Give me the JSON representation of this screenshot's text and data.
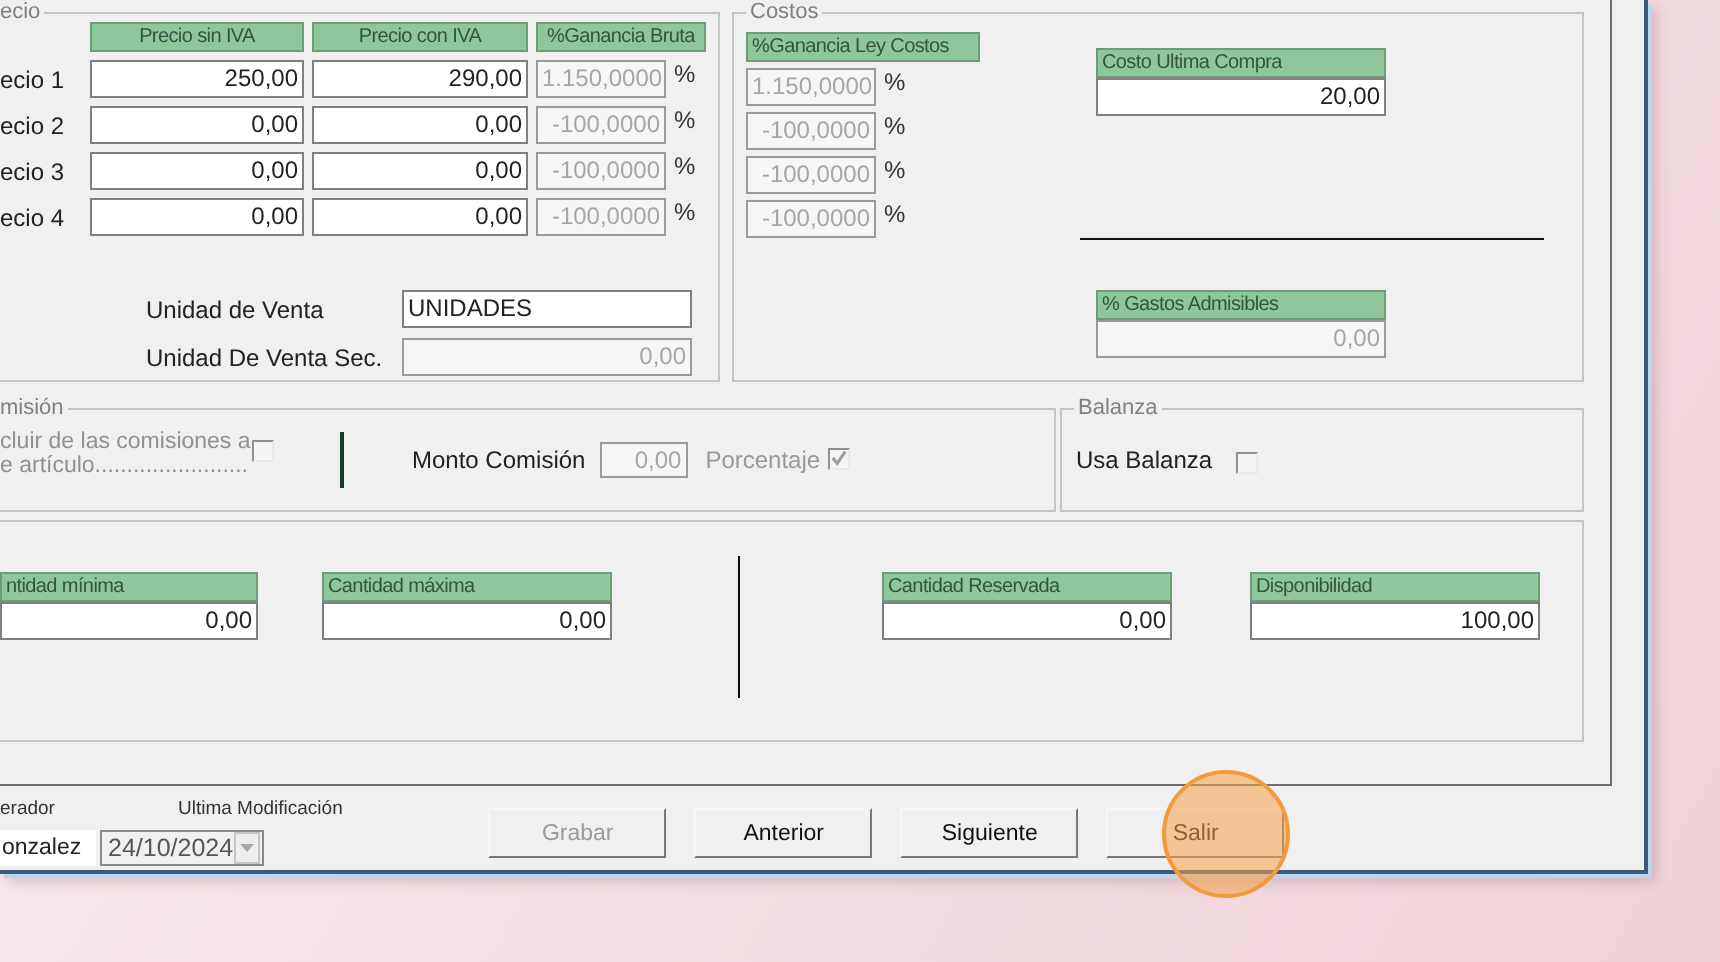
{
  "precio": {
    "legend": "ecio",
    "columns": [
      "Precio sin IVA",
      "Precio con IVA",
      "%Ganancia Bruta"
    ],
    "rows": [
      {
        "label": "ecio 1",
        "sin_iva": "250,00",
        "con_iva": "290,00",
        "ganancia": "1.150,0000",
        "unit": "%"
      },
      {
        "label": "ecio 2",
        "sin_iva": "0,00",
        "con_iva": "0,00",
        "ganancia": "-100,0000",
        "unit": "%"
      },
      {
        "label": "ecio 3",
        "sin_iva": "0,00",
        "con_iva": "0,00",
        "ganancia": "-100,0000",
        "unit": "%"
      },
      {
        "label": "ecio 4",
        "sin_iva": "0,00",
        "con_iva": "0,00",
        "ganancia": "-100,0000",
        "unit": "%"
      }
    ],
    "unidades": [
      {
        "label": "Unidad de Venta",
        "value": "UNIDADES",
        "disabled": false
      },
      {
        "label": "Unidad De Venta Sec.",
        "value": "0,00",
        "disabled": true
      }
    ]
  },
  "costos": {
    "legend": "Costos",
    "ganancia_header": "%Ganancia Ley Costos",
    "ganancia_rows": [
      {
        "value": "1.150,0000",
        "unit": "%"
      },
      {
        "value": "-100,0000",
        "unit": "%"
      },
      {
        "value": "-100,0000",
        "unit": "%"
      },
      {
        "value": "-100,0000",
        "unit": "%"
      }
    ],
    "costo_ultima_compra": {
      "label": "Costo Ultima Compra",
      "value": "20,00",
      "disabled": false
    },
    "gastos_admisibles": {
      "label": "% Gastos Admisibles",
      "value": "0,00",
      "disabled": true
    }
  },
  "comision": {
    "legend": "misión",
    "excluir_lines": [
      "cluir de las  comisiones a",
      "e artículo........................"
    ],
    "excluir_checked": false,
    "monto_label": "Monto Comisión",
    "monto_value": "0,00",
    "porcentaje_label": "Porcentaje",
    "porcentaje_checked": true
  },
  "balanza": {
    "legend": "Balanza",
    "usa_label": "Usa Balanza",
    "usa_checked": false
  },
  "cantidades": [
    {
      "label": "ntidad mínima",
      "value": "0,00"
    },
    {
      "label": "Cantidad máxima",
      "value": "0,00"
    },
    {
      "label": "Cantidad Reservada",
      "value": "0,00"
    },
    {
      "label": "Disponibilidad",
      "value": "100,00"
    }
  ],
  "footer": {
    "operador_label": "erador",
    "operador_value": "onzalez",
    "modificacion_label": "Ultima Modificación",
    "modificacion_value": "24/10/2024"
  },
  "buttons": [
    {
      "label": "Grabar",
      "disabled": true,
      "highlighted": false
    },
    {
      "label": "Anterior",
      "disabled": false,
      "highlighted": false
    },
    {
      "label": "Siguiente",
      "disabled": false,
      "highlighted": false
    },
    {
      "label": "Salir",
      "disabled": false,
      "highlighted": true
    }
  ]
}
